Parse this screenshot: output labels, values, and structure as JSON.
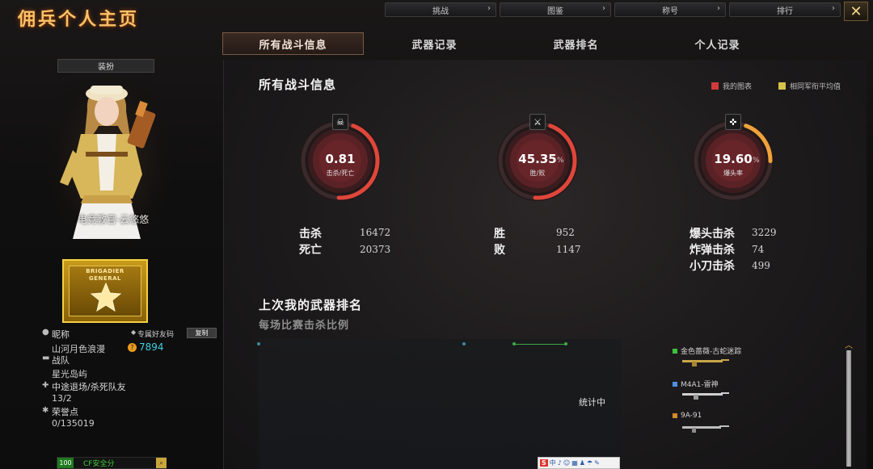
{
  "window": {
    "title": "佣兵个人主页",
    "close_label": "✕"
  },
  "top_buttons": [
    {
      "label": "挑战"
    },
    {
      "label": "图鉴"
    },
    {
      "label": "称号"
    },
    {
      "label": "排行"
    }
  ],
  "tabs": [
    {
      "label": "所有战斗信息",
      "active": true
    },
    {
      "label": "武器记录",
      "active": false
    },
    {
      "label": "武器排名",
      "active": false
    },
    {
      "label": "个人记录",
      "active": false
    }
  ],
  "profile": {
    "equip_button": "装扮",
    "avatar_name": "电竞教官-云悠悠",
    "rank_text_1": "BRIGADIER",
    "rank_text_2": "GENERAL",
    "nickname_label": "昵称",
    "nickname_value": "山河月色浪漫",
    "friend_code_label": "专属好友码",
    "copy_button": "复制",
    "friend_code_value": "7894",
    "squad_label": "战队",
    "squad_value": "星光岛屿",
    "leave_label": "中途退场/杀死队友",
    "leave_value": "13/2",
    "honor_label": "荣誉点",
    "honor_value": "0/135019",
    "level": "100",
    "safe_label": "CF安全分"
  },
  "battle_info": {
    "heading": "所有战斗信息",
    "legend_mine": "我的图表",
    "legend_avg": "相同军衔平均值",
    "colors": {
      "mine": "#d23a3a",
      "avg": "#d6c34a",
      "gauge_red": "#e0463a",
      "gauge_orange": "#f0a23a"
    },
    "gauges": [
      {
        "icon": "skull-icon",
        "glyph": "☠",
        "value": "0.81",
        "caption": "击杀/死亡",
        "pct": "",
        "fill": 0.45
      },
      {
        "icon": "crossed-swords-icon",
        "glyph": "⚔",
        "value": "45.35",
        "caption": "胜/败",
        "pct": "%",
        "fill": 0.4535
      },
      {
        "icon": "crosshair-icon",
        "glyph": "✜",
        "value": "19.60",
        "caption": "爆头率",
        "pct": "%",
        "fill": 0.196
      }
    ],
    "stats": {
      "kills_label": "击杀",
      "kills_value": "16472",
      "deaths_label": "死亡",
      "deaths_value": "20373",
      "wins_label": "胜",
      "wins_value": "952",
      "losses_label": "败",
      "losses_value": "1147",
      "headshot_label": "爆头击杀",
      "headshot_value": "3229",
      "bomb_label": "炸弹击杀",
      "bomb_value": "74",
      "knife_label": "小刀击杀",
      "knife_value": "499"
    }
  },
  "weapon_rank": {
    "heading": "上次我的武器排名",
    "subheading": "每场比赛击杀比例",
    "status_text": "统计中",
    "weapons": [
      {
        "name": "金色蔷薇-古蛇迷踪",
        "color": "#3ec23e"
      },
      {
        "name": "M4A1-雷神",
        "color": "#4f8fe0"
      },
      {
        "name": "9A-91",
        "color": "#d08a2a"
      }
    ]
  },
  "ime_bar": {
    "logo": "S",
    "items": [
      "中",
      "♪",
      "☺",
      "▦",
      "♟",
      "☂",
      "✎"
    ]
  }
}
